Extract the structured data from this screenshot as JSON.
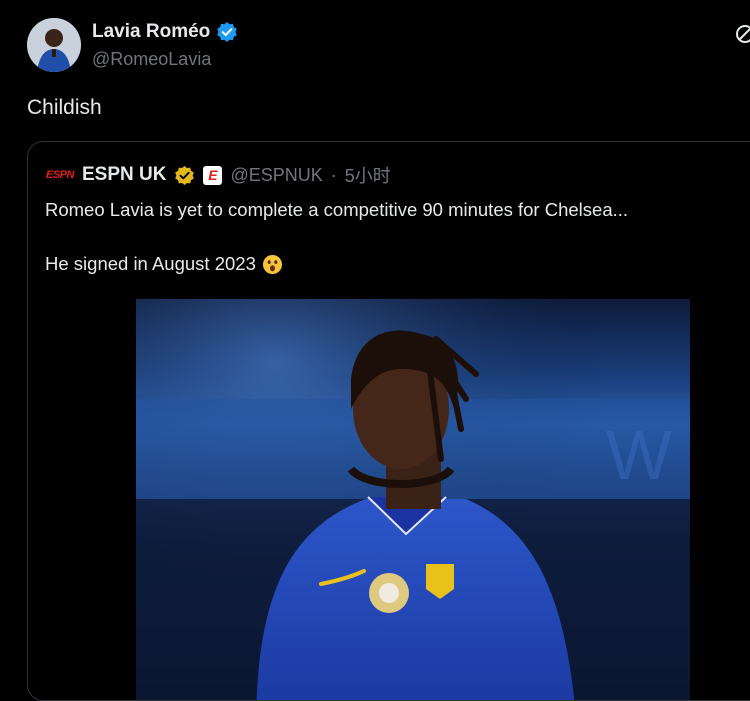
{
  "tweet": {
    "display_name": "Lavia Roméo",
    "handle": "@RomeoLavia",
    "text": "Childish",
    "verified_icon": "verified-badge-icon",
    "avatar_icon": "avatar"
  },
  "quoted_tweet": {
    "brand_label": "ESPN",
    "display_name": "ESPN UK",
    "handle": "@ESPNUK",
    "separator": "·",
    "timestamp": "5小时",
    "line1": "Romeo Lavia is yet to complete a competitive 90 minutes for Chelsea...",
    "line2": "He signed in August 2023",
    "emoji_icon": "astonished-face-emoji",
    "gold_badge_icon": "gold-verified-badge-icon",
    "e_logo_label": "E",
    "photo_description_icon": "player-photo"
  },
  "colors": {
    "background": "#000000",
    "primary_text": "#e7e9ea",
    "secondary_text": "#71767b",
    "border": "#2f3336",
    "verified_blue": "#1d9bf0",
    "gold_badge": "#e2b719",
    "espn_red": "#e0201c"
  }
}
